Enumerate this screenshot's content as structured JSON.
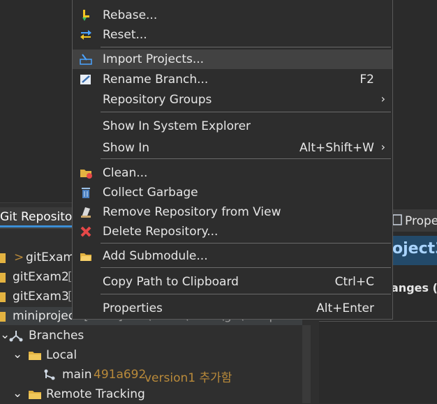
{
  "menu": {
    "items": [
      {
        "label": "Rebase...",
        "icon": "rebase-icon"
      },
      {
        "label": "Reset...",
        "icon": "reset-icon"
      },
      {
        "label": "Import Projects...",
        "icon": "import-projects-icon"
      },
      {
        "label": "Rename Branch...",
        "accel": "F2",
        "icon": "rename-icon"
      },
      {
        "label": "Repository Groups",
        "submenu": "›"
      },
      {
        "label": "Show In System Explorer"
      },
      {
        "label": "Show In",
        "accel": "Alt+Shift+W",
        "submenu": "›"
      },
      {
        "label": "Clean...",
        "icon": "clean-icon"
      },
      {
        "label": "Collect Garbage",
        "icon": "trash-icon"
      },
      {
        "label": "Remove Repository from View",
        "icon": "remove-icon"
      },
      {
        "label": "Delete Repository...",
        "icon": "delete-icon"
      },
      {
        "label": "Add Submodule...",
        "icon": "add-submodule-icon"
      },
      {
        "label": "Copy Path to Clipboard",
        "accel": "Ctrl+C"
      },
      {
        "label": "Properties",
        "accel": "Alt+Enter"
      }
    ]
  },
  "repo_view": {
    "tab_label": "Git Repositor",
    "rows": [
      {
        "prefix": ">",
        "name": "gitExam"
      },
      {
        "name": "gitExam2",
        "suffix": "["
      },
      {
        "name": "gitExam3",
        "suffix": "["
      },
      {
        "name": "miniproject",
        "suffix": "[main] - C:\\Users\\USER\\git\\minip"
      },
      {
        "name": "Branches"
      },
      {
        "name": "Local"
      },
      {
        "name": "main",
        "commit": "491a692",
        "message": "version1 추가함"
      },
      {
        "name": "Remote Tracking"
      }
    ]
  },
  "properties_view": {
    "tab_label": "Prope",
    "title": "oject3",
    "changes": "anges ("
  },
  "colors": {
    "accent": "#3c8fd6",
    "menu_bg": "#2d2d2d",
    "highlight": "#424242",
    "muted_text": "#b98a3a"
  }
}
